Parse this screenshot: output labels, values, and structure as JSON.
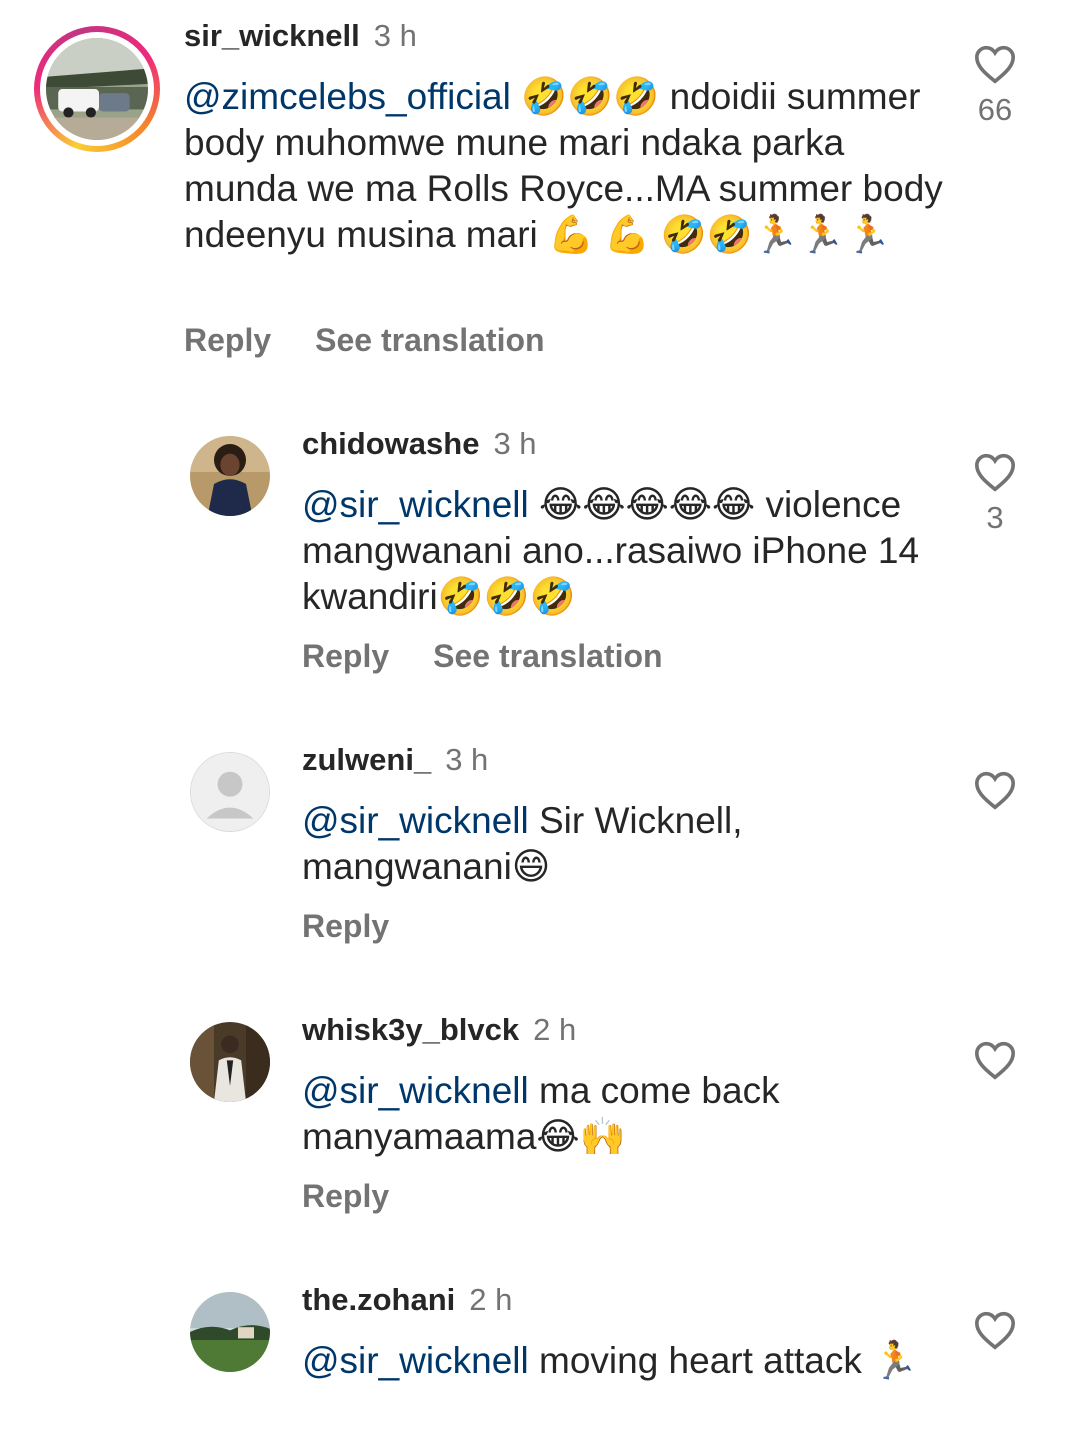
{
  "comments": [
    {
      "username": "sir_wicknell",
      "time": "3 h",
      "mention": "@zimcelebs_official",
      "text": " 🤣🤣🤣 ndoidii summer body muhomwe mune mari ndaka parka munda we ma Rolls Royce...MA summer body ndeenyu musina mari 💪 💪 🤣🤣🏃🏃🏃",
      "reply_label": "Reply",
      "translate_label": "See translation",
      "likes": "66",
      "avatar_icon": "rolls-royce-avatar"
    },
    {
      "username": "chidowashe",
      "time": "3 h",
      "mention": "@sir_wicknell",
      "text": " 😂😂😂😂😂 violence mangwanani ano...rasaiwo iPhone 14 kwandiri🤣🤣🤣",
      "reply_label": "Reply",
      "translate_label": "See translation",
      "likes": "3",
      "avatar_icon": "woman-avatar"
    },
    {
      "username": "zulweni_",
      "time": "3 h",
      "mention": "@sir_wicknell",
      "text": " Sir Wicknell, mangwanani😄",
      "reply_label": "Reply",
      "likes": "",
      "avatar_icon": "default-user-avatar"
    },
    {
      "username": "whisk3y_blvck",
      "time": "2 h",
      "mention": "@sir_wicknell",
      "text": " ma come back manyamaama😂🙌",
      "reply_label": "Reply",
      "likes": "",
      "avatar_icon": "man-suit-avatar"
    },
    {
      "username": "the.zohani",
      "time": "2 h",
      "mention": "@sir_wicknell",
      "text": " moving heart attack 🏃",
      "reply_label": "",
      "likes": "",
      "avatar_icon": "landscape-avatar"
    }
  ],
  "colors": {
    "mention": "#00376b",
    "secondary_text": "#737373",
    "primary_text": "#262626"
  }
}
